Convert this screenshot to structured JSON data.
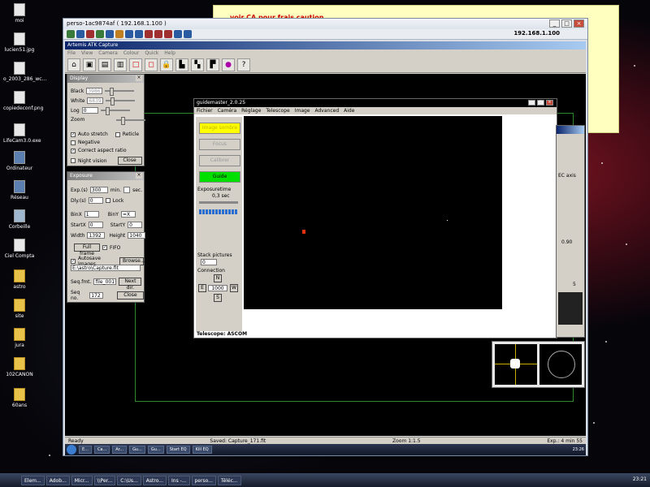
{
  "desktop_icons": [
    {
      "label": "moi",
      "kind": "doc"
    },
    {
      "label": "lucien51.jpg",
      "kind": "doc"
    },
    {
      "label": "o_2003_286_wc...",
      "kind": "doc"
    },
    {
      "label": "copiedeconf.png",
      "kind": "doc"
    },
    {
      "label": "LifeCam3.0.exe",
      "kind": "doc"
    },
    {
      "label": "Ordinateur",
      "kind": "pc"
    },
    {
      "label": "Réseau",
      "kind": "pc"
    },
    {
      "label": "Corbeille",
      "kind": "bin"
    },
    {
      "label": "Ciel Compta",
      "kind": "doc"
    },
    {
      "label": "astro",
      "kind": "folder"
    },
    {
      "label": "site",
      "kind": "folder"
    },
    {
      "label": "jura",
      "kind": "folder"
    },
    {
      "label": "102CANON",
      "kind": "folder"
    },
    {
      "label": "60ans",
      "kind": "folder"
    }
  ],
  "note": {
    "text": "voir CA pour frais caution"
  },
  "rdp": {
    "title": "perso-1ac9874af ( 192.168.1.100 )",
    "ip": "192.168.1.100"
  },
  "atk": {
    "title": "Artemis ATK Capture",
    "menu": [
      "File",
      "View",
      "Camera",
      "Colour",
      "Quick",
      "Help"
    ],
    "status_left": "Ready",
    "status_saved": "Saved: Capture_171.fit",
    "status_zoom": "Zoom 1:1.5",
    "status_exp": "Exp.: 4 min 55"
  },
  "display_panel": {
    "title": "Display",
    "black_label": "Black",
    "black_value": "3986",
    "white_label": "White",
    "white_value": "6839",
    "log_label": "Log",
    "log_value": "0",
    "zoom_label": "Zoom",
    "auto_stretch": "Auto stretch",
    "reticle": "Reticle",
    "negative": "Negative",
    "correct_aspect": "Correct aspect ratio",
    "night_vision": "Night vision",
    "close": "Close"
  },
  "exposure_panel": {
    "title": "Exposure",
    "exp_label": "Exp.(s)",
    "exp_value": "300",
    "min": "min.",
    "sec": "sec.",
    "dly_label": "Dly.(s)",
    "dly_value": "0",
    "lock": "Lock",
    "binx_label": "BinX",
    "binx_value": "1",
    "biny_label": "BinY",
    "biny_value": "=X",
    "startx_label": "StartX",
    "startx_value": "0",
    "starty_label": "StartY",
    "starty_value": "0",
    "width_label": "Width",
    "width_value": "1392",
    "height_label": "Height",
    "height_value": "1040",
    "full_frame": "Full frame",
    "fifo": "FIFO",
    "autosave": "Autosave Images",
    "browse": "Browse...",
    "path": "E:\\astro\\Capture.fit",
    "seqfmt_label": "Seq.fmt.",
    "seqfmt_value": "file_001",
    "next_dir": "Next dir.",
    "seqno_label": "Seq no.",
    "seqno_value": "172",
    "close": "Close"
  },
  "guidemaster": {
    "title": "guidemaster_2.0.25",
    "menu": [
      "Fichier",
      "Caméra",
      "Réglage",
      "Telescope",
      "Image",
      "Advanced",
      "Aide"
    ],
    "btn_dark": "Image sombre",
    "btn_focus": "Focus",
    "btn_calib": "Calibrer",
    "btn_guide": "Guide",
    "exposure_label": "Exposuretime",
    "exposure_value": "0,3 sec",
    "stack_label": "Stack pictures",
    "stack_value": "0",
    "connection_label": "Connection",
    "n": "N",
    "e": "E",
    "w": "W",
    "s": "S",
    "speed": "1000",
    "status": "Telescope: ASCOM",
    "accent_guide": "#00e000",
    "accent_dark": "#ffff00"
  },
  "right_window": {
    "axis": "EC axis",
    "value": "0.90",
    "count": "5"
  },
  "inner_taskbar": [
    "E...",
    "Ca...",
    "Ar...",
    "Gu...",
    "Gu...",
    "Start EQ",
    "Kill EQ"
  ],
  "inner_clock": "23:26",
  "taskbar": {
    "items": [
      "Elem...",
      "Adob...",
      "Micr...",
      "\\\\Per...",
      "C:\\Us...",
      "Astro...",
      "Ins -...",
      "perso...",
      "Téléc..."
    ],
    "clock": "23:21"
  }
}
